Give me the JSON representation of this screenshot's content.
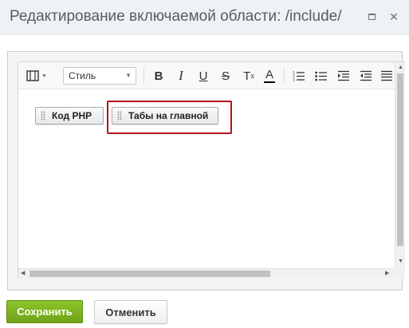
{
  "dialog": {
    "title": "Редактирование включаемой области: /include/"
  },
  "toolbar": {
    "style_select": "Стиль",
    "bold": "B",
    "italic": "I",
    "underline": "U",
    "strike": "S",
    "clear_format": "T",
    "clear_format_sub": "x",
    "font_color": "A"
  },
  "content": {
    "blocks": [
      {
        "label": "Код PHP"
      },
      {
        "label": "Табы на главной"
      }
    ]
  },
  "footer": {
    "save_label": "Сохранить",
    "cancel_label": "Отменить"
  },
  "colors": {
    "highlight": "#b3121c",
    "save_button": "#7bb31e",
    "titlebar": "#eef2f4"
  }
}
